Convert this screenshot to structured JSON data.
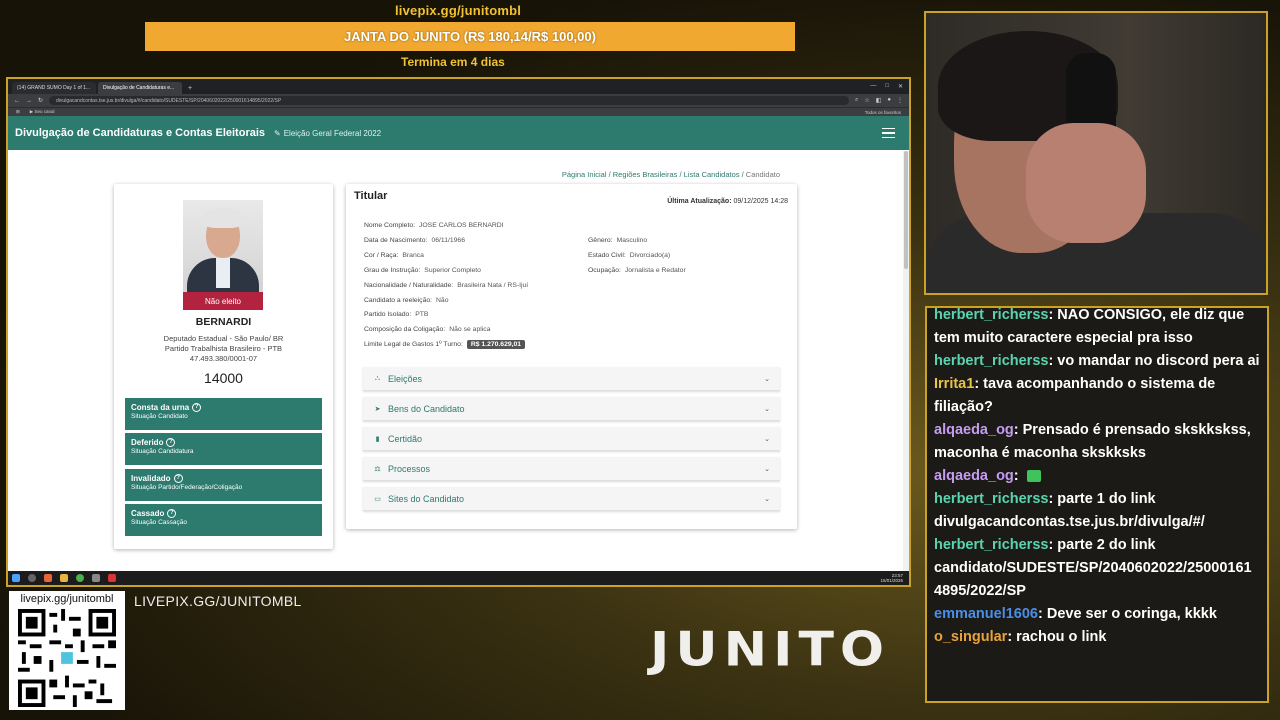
{
  "overlay": {
    "pix_url": "livepix.gg/junitombl",
    "goal_label": "JANTA DO JUNITO (R$ 180,14/R$ 100,00)",
    "goal_ends": "Termina em 4 dias",
    "qr_label": "livepix.gg/junitombl",
    "pix_text": "LIVEPIX.GG/JUNITOMBL",
    "logo": "JUNITO"
  },
  "browser": {
    "tabs": [
      {
        "label": "(14) GRAND SUMO Day 1 of 1..."
      },
      {
        "label": "Divulgação de Candidaturas e..."
      }
    ],
    "url": "divulgacandcontas.tse.jus.br/divulga/#/candidato/SUDESTE/SP/2040602022/250001614895/2022/SP",
    "bookmarks": [
      "Seu canal"
    ],
    "bookmarks_right": "Todos os favoritos"
  },
  "app": {
    "title": "Divulgação de Candidaturas e Contas Eleitorais",
    "election": "Eleição Geral Federal 2022",
    "breadcrumb": {
      "home": "Página Inicial",
      "regions": "Regiões Brasileiras",
      "list": "Lista Candidatos",
      "current": "Candidato"
    }
  },
  "candidate": {
    "status_badge": "Não eleito",
    "name": "BERNARDI",
    "office": "Deputado Estadual - São Paulo/ BR",
    "party": "Partido Trabalhista Brasileiro - PTB",
    "cnpj": "47.493.380/0001-07",
    "number": "14000",
    "statuses": [
      {
        "title": "Consta da urna",
        "subtitle": "Situação Candidato"
      },
      {
        "title": "Deferido",
        "subtitle": "Situação Candidatura"
      },
      {
        "title": "Invalidado",
        "subtitle": "Situação Partido/Federação/Coligação"
      },
      {
        "title": "Cassado",
        "subtitle": "Situação Cassação"
      }
    ]
  },
  "details": {
    "title": "Titular",
    "updated_label": "Última Atualização:",
    "updated_value": "09/12/2025 14:28",
    "fields": {
      "nome_label": "Nome Completo:",
      "nome": "JOSE CARLOS BERNARDI",
      "nasc_label": "Data de Nascimento:",
      "nasc": "06/11/1966",
      "genero_label": "Gênero:",
      "genero": "Masculino",
      "cor_label": "Cor / Raça:",
      "cor": "Branca",
      "civil_label": "Estado Civil:",
      "civil": "Divorciado(a)",
      "grau_label": "Grau de Instrução:",
      "grau": "Superior Completo",
      "ocup_label": "Ocupação:",
      "ocup": "Jornalista e Redator",
      "nac_label": "Nacionalidade / Naturalidade:",
      "nac": "Brasileira Nata / RS-Ijuí",
      "reel_label": "Candidato a reeleição:",
      "reel": "Não",
      "partido_label": "Partido Isolado:",
      "partido": "PTB",
      "comp_label": "Composição da Coligação:",
      "comp": "Não se aplica",
      "limite_label": "Limite Legal de Gastos 1º Turno:",
      "limite": "R$ 1.270.629,01"
    },
    "sections": [
      {
        "label": "Eleições"
      },
      {
        "label": "Bens do Candidato"
      },
      {
        "label": "Certidão"
      },
      {
        "label": "Processos"
      },
      {
        "label": "Sites do Candidato"
      }
    ]
  },
  "taskbar": {
    "time": "23:57",
    "date": "15/01/2026"
  },
  "chat": [
    {
      "user": "herbert_richerss",
      "color": "#5ad4b0",
      "text": ": NÃO CONSIGO, ele diz que tem muito caractere especial pra isso"
    },
    {
      "user": "herbert_richerss",
      "color": "#5ad4b0",
      "text": ": vo mandar no discord pera ai"
    },
    {
      "user": "Irrita1",
      "color": "#e8c547",
      "text": ": tava acompanhando o sistema de filiação?"
    },
    {
      "user": "alqaeda_og",
      "color": "#c59cf2",
      "text": ": Prensado é prensado skskkskss, maconha é maconha skskksks"
    },
    {
      "user": "alqaeda_og",
      "color": "#c59cf2",
      "text": ": "
    },
    {
      "user": "herbert_richerss",
      "color": "#5ad4b0",
      "text": ": parte 1 do link divulgacandcontas.tse.jus.br/divulga/#/"
    },
    {
      "user": "herbert_richerss",
      "color": "#5ad4b0",
      "text": ": parte 2 do link candidato/SUDESTE/SP/2040602022/25000161 4895/2022/SP"
    },
    {
      "user": "emmanuel1606",
      "color": "#4a8fe7",
      "text": ": Deve ser o coringa, kkkk"
    },
    {
      "user": "o_singular",
      "color": "#e8a33a",
      "text": ": rachou o link"
    }
  ]
}
